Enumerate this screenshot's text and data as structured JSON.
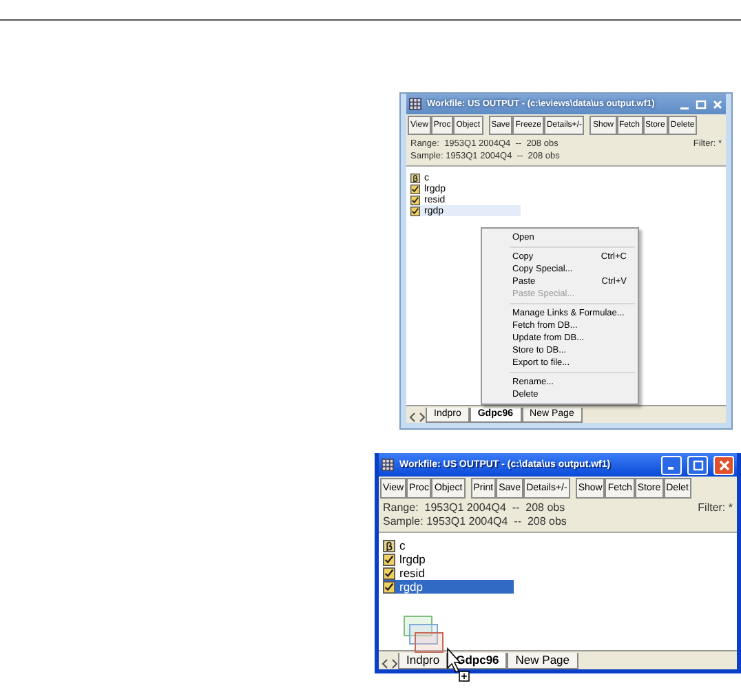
{
  "windows": [
    {
      "title": "Workfile: US OUTPUT - (c:\\eviews\\data\\us output.wf1)",
      "toolbar": [
        [
          "View",
          "Proc",
          "Object"
        ],
        [
          "Save",
          "Freeze",
          "Details+/-"
        ],
        [
          "Show",
          "Fetch",
          "Store",
          "Delete"
        ]
      ],
      "range": "Range:  1953Q1 2004Q4  --  208 obs",
      "sample": "Sample: 1953Q1 2004Q4  --  208 obs",
      "filter": "Filter: *",
      "objects": [
        {
          "kind": "coef",
          "name": "c",
          "selected": false
        },
        {
          "kind": "series",
          "name": "lrgdp",
          "selected": false
        },
        {
          "kind": "series",
          "name": "resid",
          "selected": false
        },
        {
          "kind": "series",
          "name": "rgdp",
          "selected": true
        }
      ],
      "tabs": [
        {
          "label": "Indpro",
          "selected": false
        },
        {
          "label": "Gdpc96",
          "selected": true
        },
        {
          "label": "New Page",
          "selected": false
        }
      ],
      "dragging": false,
      "context_menu": [
        {
          "kind": "item",
          "label": "Open",
          "disabled": false
        },
        {
          "kind": "separator"
        },
        {
          "kind": "item",
          "label": "Copy",
          "shortcut": "Ctrl+C",
          "disabled": false
        },
        {
          "kind": "item",
          "label": "Copy Special...",
          "disabled": false
        },
        {
          "kind": "item",
          "label": "Paste",
          "shortcut": "Ctrl+V",
          "disabled": false
        },
        {
          "kind": "item",
          "label": "Paste Special...",
          "disabled": true
        },
        {
          "kind": "separator"
        },
        {
          "kind": "item",
          "label": "Manage Links & Formulae...",
          "disabled": false
        },
        {
          "kind": "item",
          "label": "Fetch from DB...",
          "disabled": false
        },
        {
          "kind": "item",
          "label": "Update from DB...",
          "disabled": false
        },
        {
          "kind": "item",
          "label": "Store to DB...",
          "disabled": false
        },
        {
          "kind": "item",
          "label": "Export to file...",
          "disabled": false
        },
        {
          "kind": "separator"
        },
        {
          "kind": "item",
          "label": "Rename...",
          "disabled": false
        },
        {
          "kind": "item",
          "label": "Delete",
          "disabled": false
        }
      ]
    },
    {
      "title": "Workfile: US OUTPUT - (c:\\data\\us output.wf1)",
      "toolbar": [
        [
          "View",
          "Proc",
          "Object"
        ],
        [
          "Print",
          "Save",
          "Details+/-"
        ],
        [
          "Show",
          "Fetch",
          "Store",
          "Delet"
        ]
      ],
      "range": "Range:  1953Q1 2004Q4  --  208 obs",
      "sample": "Sample: 1953Q1 2004Q4  --  208 obs",
      "filter": "Filter: *",
      "objects": [
        {
          "kind": "coef",
          "name": "c",
          "selected": false
        },
        {
          "kind": "series",
          "name": "lrgdp",
          "selected": false
        },
        {
          "kind": "series",
          "name": "resid",
          "selected": false
        },
        {
          "kind": "series",
          "name": "rgdp",
          "selected": true
        }
      ],
      "tabs": [
        {
          "label": "Indpro",
          "selected": false
        },
        {
          "label": "Gdpc96",
          "selected": true
        },
        {
          "label": "New Page",
          "selected": false
        }
      ],
      "dragging": true
    }
  ]
}
